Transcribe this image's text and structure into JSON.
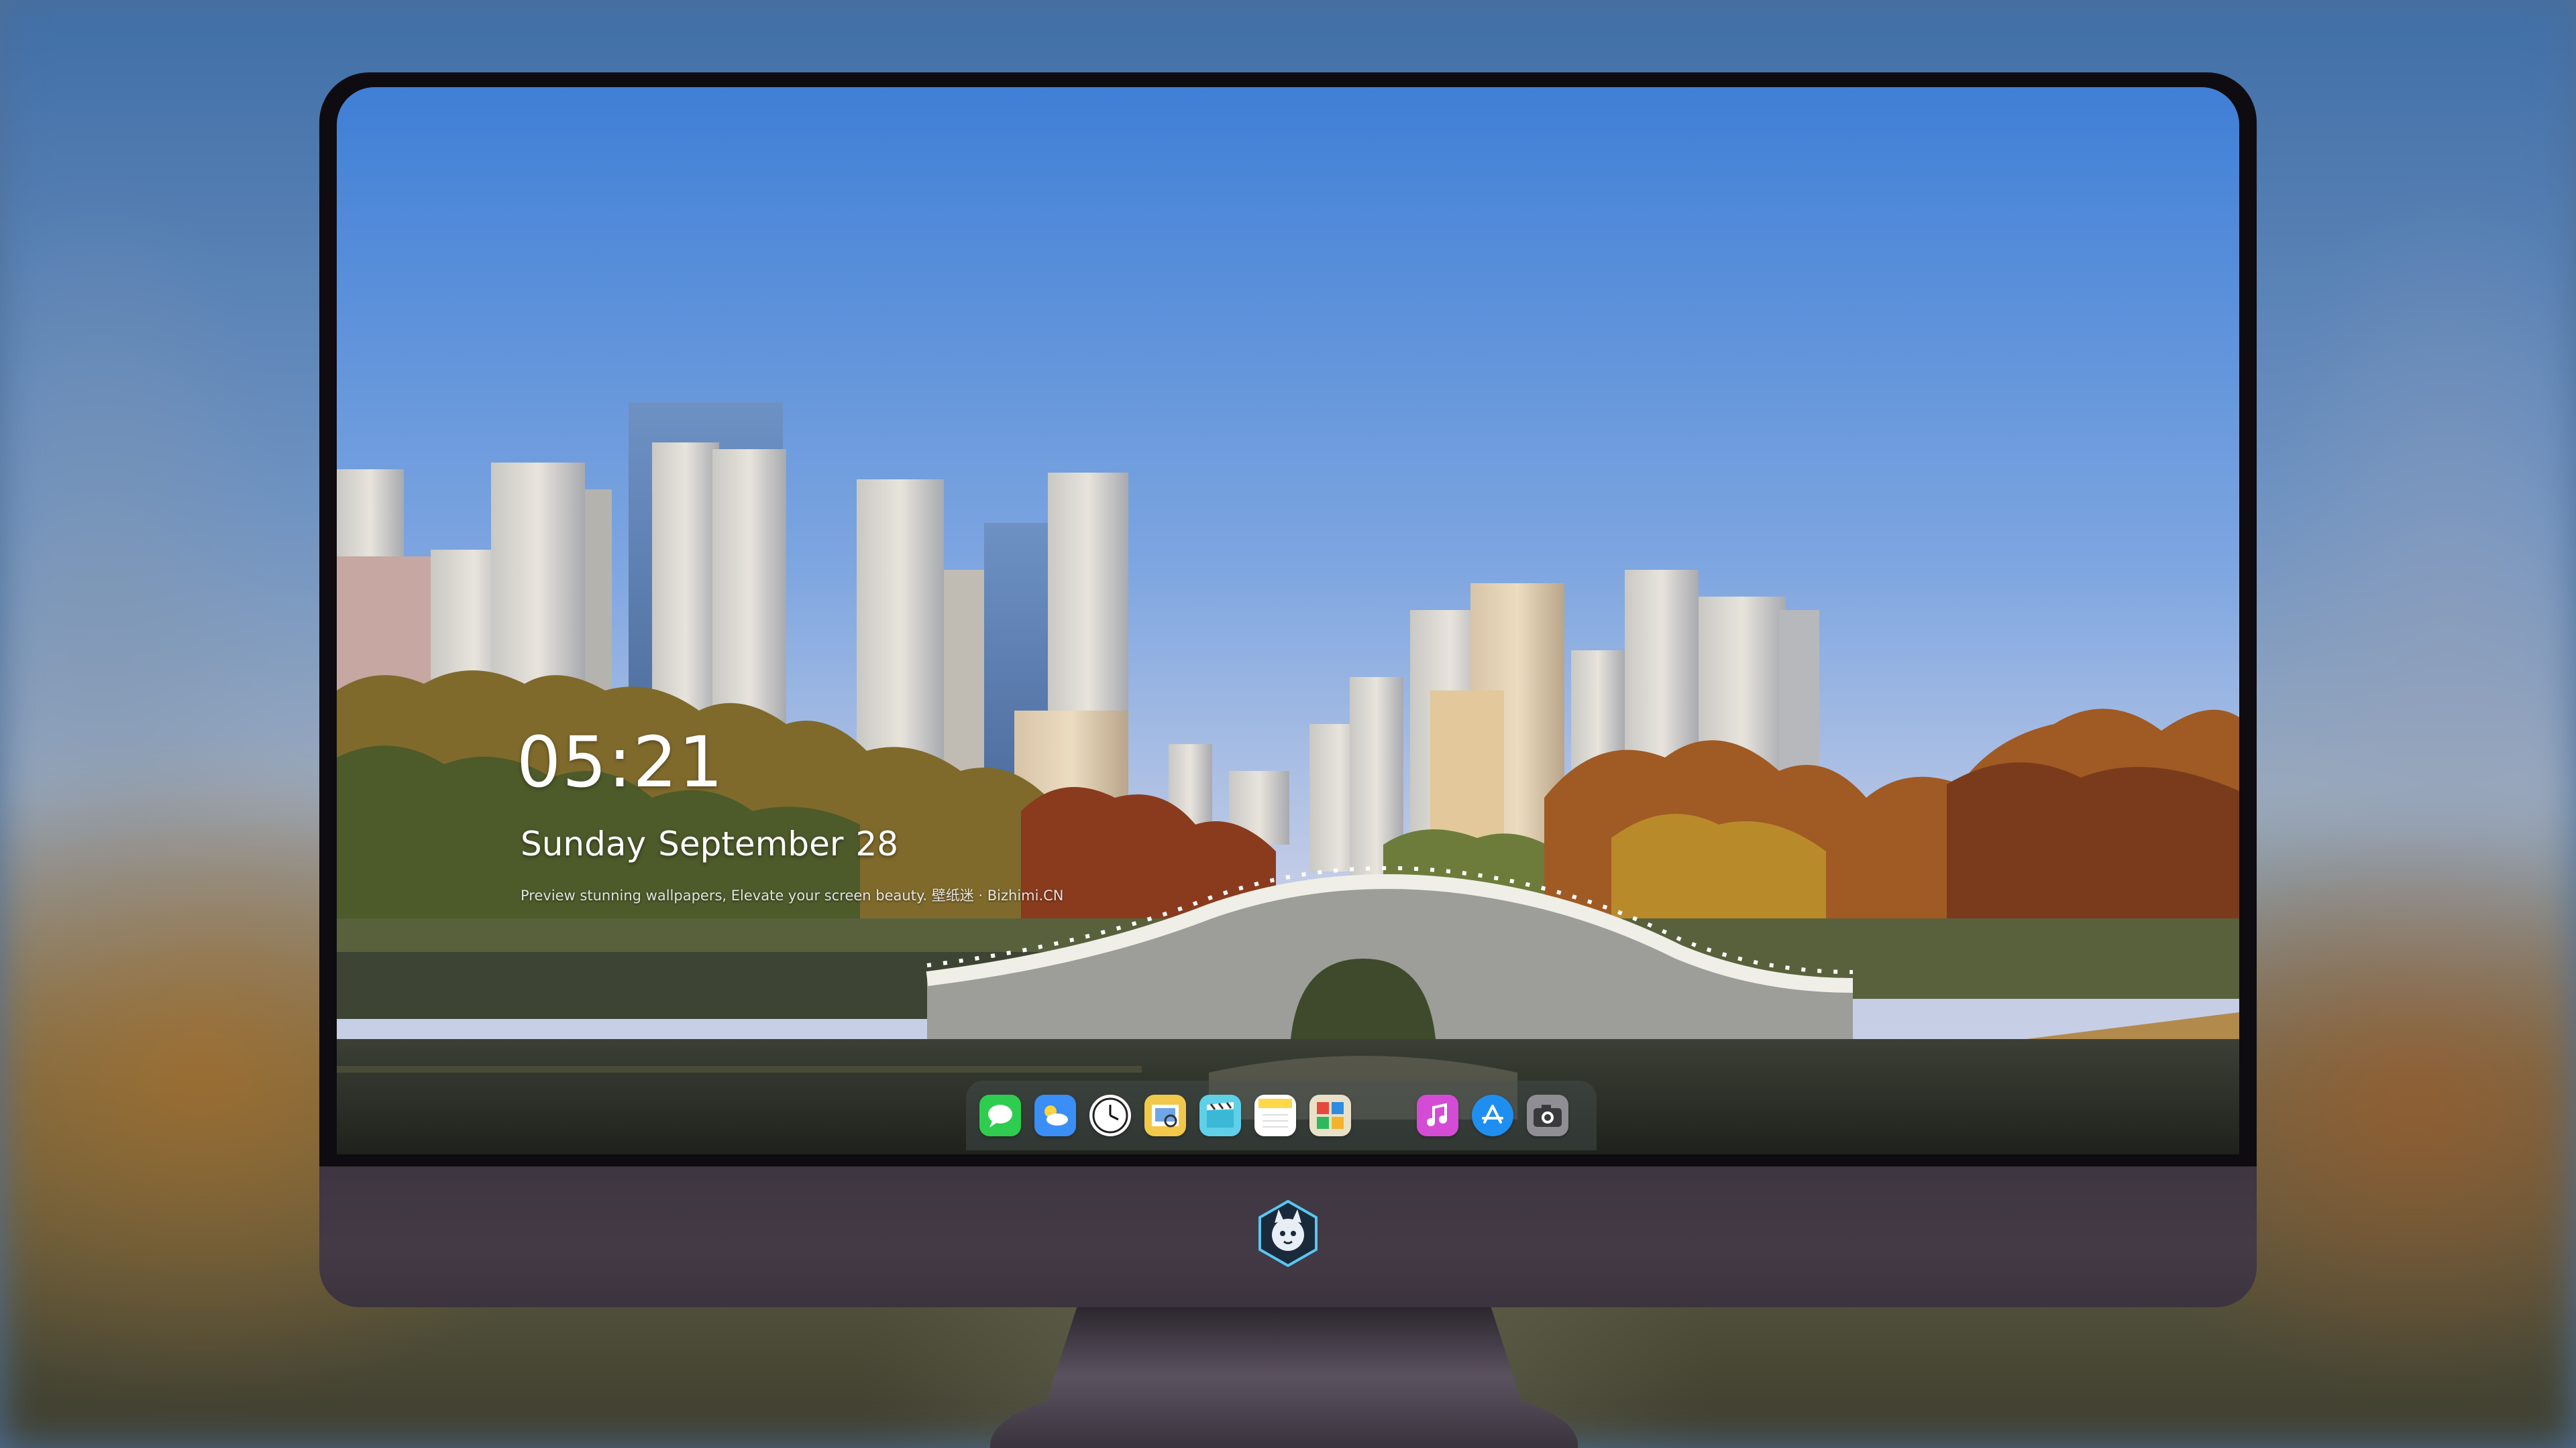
{
  "lockscreen": {
    "time": "05:21",
    "date_weekday": "Sunday",
    "date_month": "September",
    "date_day": "28",
    "tagline": "Preview stunning wallpapers, Elevate your screen beauty.  壁纸迷 · Bizhimi.CN"
  },
  "dock": {
    "apps": [
      {
        "icon": "messages-icon",
        "color": "#2ecc4f"
      },
      {
        "icon": "weather-icon",
        "color": "#3a8ef5"
      },
      {
        "icon": "clock-icon",
        "color": "#ffffff"
      },
      {
        "icon": "preview-icon",
        "color": "#f2c84b"
      },
      {
        "icon": "clips-icon",
        "color": "#5fd0e8"
      },
      {
        "icon": "notes-icon",
        "color": "#ffd84a"
      },
      {
        "icon": "photo-booth-icon",
        "color": "#e8e1c8"
      },
      {
        "icon": "itunes-icon",
        "color": "#d44cd6"
      },
      {
        "icon": "app-store-icon",
        "color": "#1e8ff0"
      },
      {
        "icon": "camera-icon",
        "color": "#8e8e93"
      }
    ]
  },
  "brand": {
    "chin_logo": "fox-mascot-logo"
  }
}
